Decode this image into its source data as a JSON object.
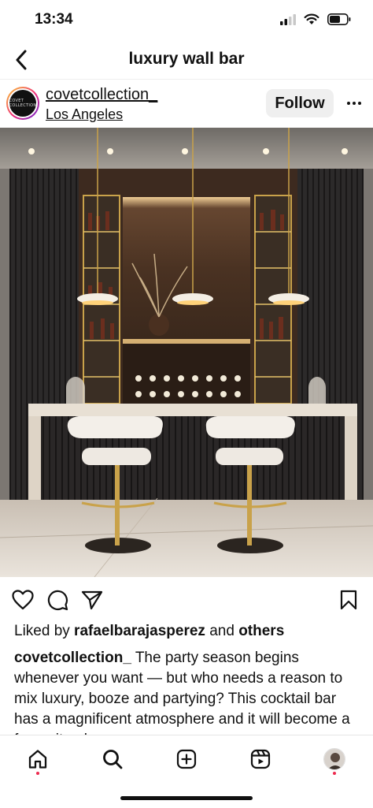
{
  "status": {
    "time": "13:34"
  },
  "nav": {
    "title": "luxury wall bar"
  },
  "post": {
    "username": "covetcollection_",
    "location": "Los Angeles",
    "avatar_text": "COVET COLLECTION",
    "follow_label": "Follow",
    "more_label": "•••"
  },
  "likes": {
    "prefix": "Liked by ",
    "user": "rafaelbarajasperez",
    "middle": " and ",
    "others": "others"
  },
  "caption": {
    "user": "covetcollection_",
    "text": " The party season begins whenever you want — but who needs a reason to mix luxury, booze and partying? This cocktail bar has a magnificent atmosphere and it will become a favourite place"
  },
  "icons": {
    "back": "chevron-left-icon",
    "more": "more-horizontal-icon",
    "like": "heart-icon",
    "comment": "comment-icon",
    "share": "send-icon",
    "save": "bookmark-icon",
    "home": "home-icon",
    "search": "search-icon",
    "create": "plus-square-icon",
    "reels": "reels-icon",
    "profile": "profile-avatar"
  },
  "colors": {
    "accent_dot": "#ed2b4f",
    "follow_bg": "#efefef",
    "story_ring": [
      "#f9ce34",
      "#ee2a7b",
      "#6228d7"
    ]
  }
}
